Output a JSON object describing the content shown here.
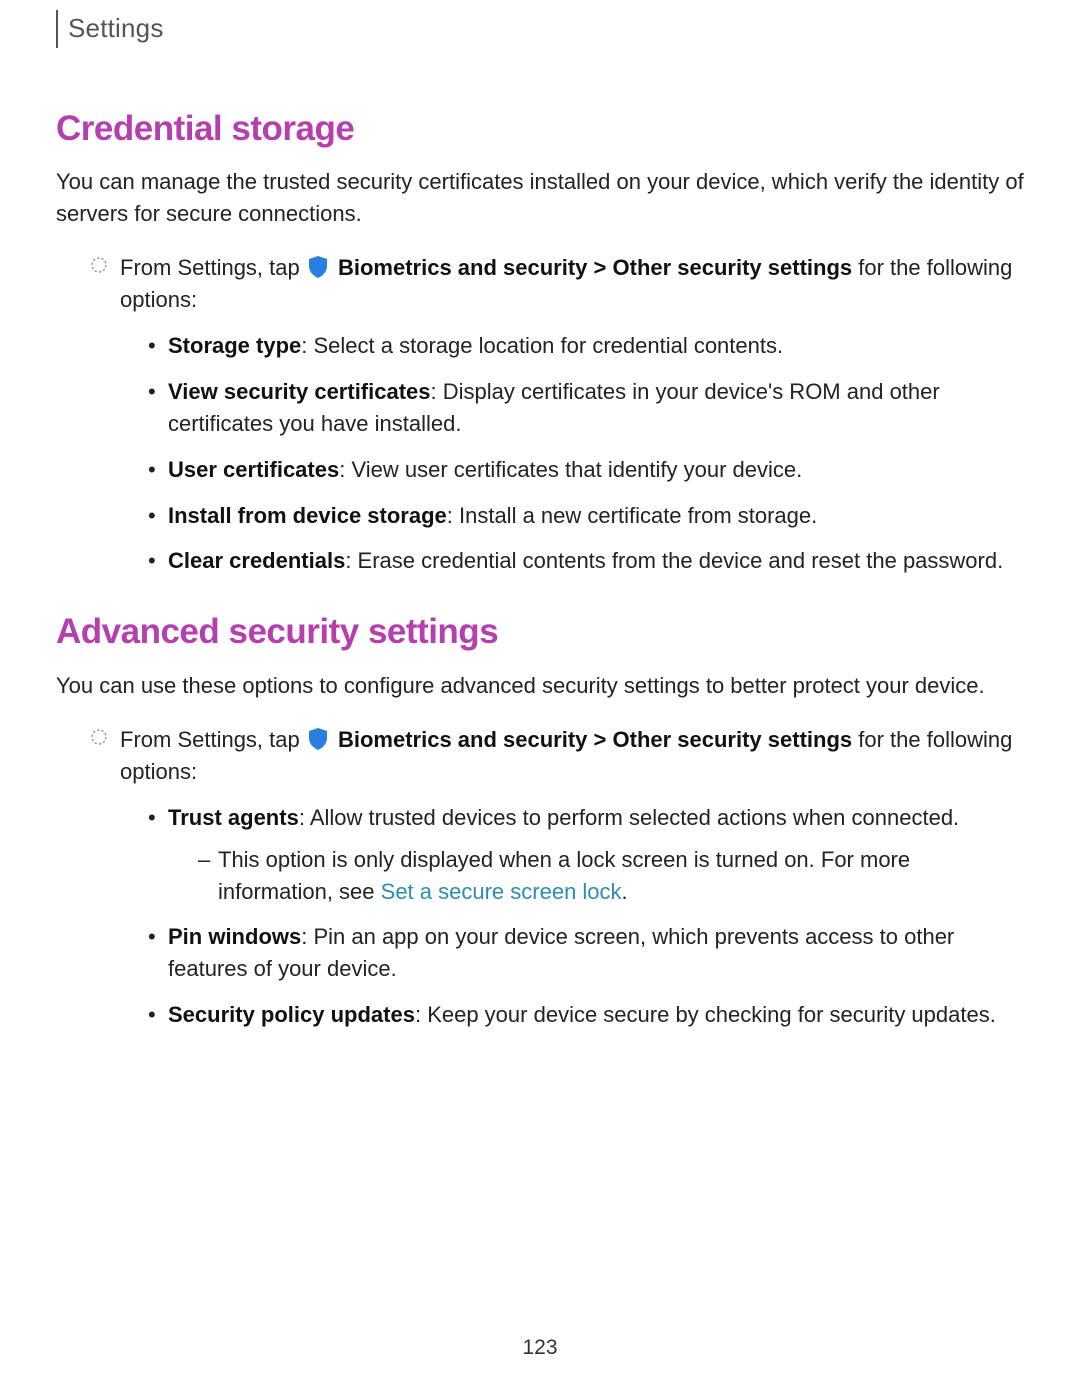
{
  "header": {
    "breadcrumb": "Settings"
  },
  "section1": {
    "title": "Credential storage",
    "intro": "You can manage the trusted security certificates installed on your device, which verify the identity of servers for secure connections.",
    "step_prefix": "From Settings, tap ",
    "step_nav1": "Biometrics and security",
    "step_nav_sep": " > ",
    "step_nav2": "Other security settings",
    "step_suffix": " for the following options:",
    "options": [
      {
        "label": "Storage type",
        "desc": ": Select a storage location for credential contents."
      },
      {
        "label": "View security certificates",
        "desc": ": Display certificates in your device's ROM and other certificates you have installed."
      },
      {
        "label": "User certificates",
        "desc": ": View user certificates that identify your device."
      },
      {
        "label": "Install from device storage",
        "desc": ": Install a new certificate from storage."
      },
      {
        "label": "Clear credentials",
        "desc": ": Erase credential contents from the device and reset the password."
      }
    ]
  },
  "section2": {
    "title": "Advanced security settings",
    "intro": "You can use these options to configure advanced security settings to better protect your device.",
    "step_prefix": "From Settings, tap ",
    "step_nav1": "Biometrics and security",
    "step_nav_sep": " > ",
    "step_nav2": "Other security settings",
    "step_suffix": " for the following options:",
    "options": [
      {
        "label": "Trust agents",
        "desc": ": Allow trusted devices to perform selected actions when connected.",
        "sub_prefix": "This option is only displayed when a lock screen is turned on. For more information, see ",
        "sub_link": "Set a secure screen lock",
        "sub_suffix": "."
      },
      {
        "label": "Pin windows",
        "desc": ": Pin an app on your device screen, which prevents access to other features of your device."
      },
      {
        "label": "Security policy updates",
        "desc": ": Keep your device secure by checking for security updates."
      }
    ]
  },
  "page_number": "123"
}
